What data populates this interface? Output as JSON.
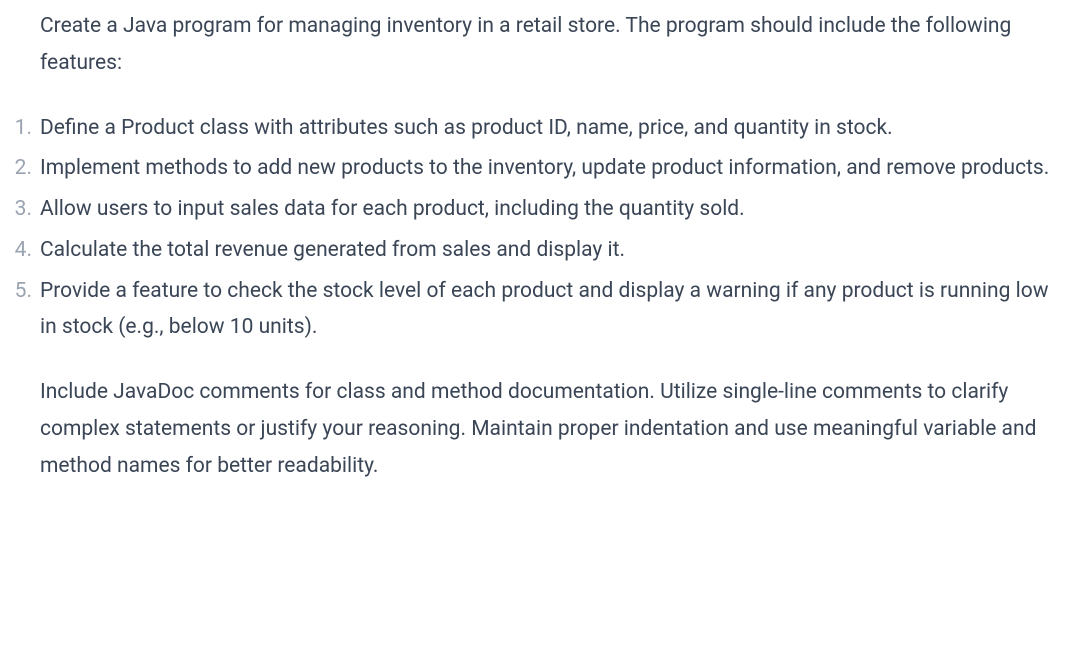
{
  "intro": "Create a Java program for managing inventory in a retail store. The program should include the following features:",
  "features": [
    "Define a Product class with attributes such as product ID, name, price, and quantity in stock.",
    "Implement methods to add new products to the inventory, update product information, and remove products.",
    "Allow users to input sales data for each product, including the quantity sold.",
    "Calculate the total revenue generated from sales and display it.",
    "Provide a feature to check the stock level of each product and display a warning if any product is running low in stock (e.g., below 10 units)."
  ],
  "outro": "Include JavaDoc comments for class and method documentation. Utilize single-line comments to clarify complex statements or justify your reasoning. Maintain proper indentation and use meaningful variable and method names for better readability."
}
